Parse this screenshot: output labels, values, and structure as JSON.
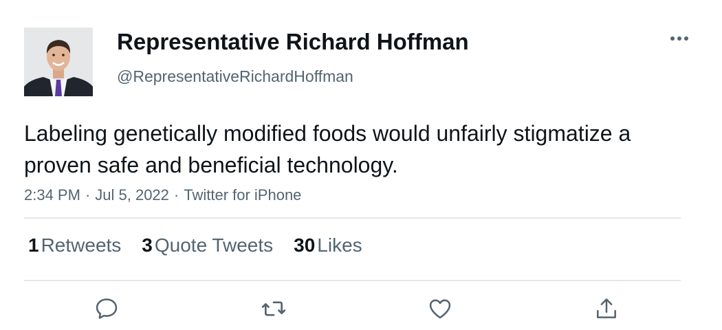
{
  "author": {
    "display_name": "Representative Richard Hoffman",
    "handle": "@RepresentativeRichardHoffman",
    "avatar_icon": "profile-photo"
  },
  "tweet": {
    "text": "Labeling genetically modified foods would unfairly stigmatize a proven safe and beneficial technology.",
    "time": "2:34 PM",
    "date": "Jul 5, 2022",
    "source": "Twitter for iPhone",
    "separator": "·"
  },
  "stats": {
    "retweets": {
      "count": "1",
      "label": "Retweets"
    },
    "quotes": {
      "count": "3",
      "label": "Quote Tweets"
    },
    "likes": {
      "count": "30",
      "label": "Likes"
    }
  },
  "actions": {
    "reply_icon": "reply-icon",
    "retweet_icon": "retweet-icon",
    "like_icon": "like-icon",
    "share_icon": "share-icon",
    "more_icon": "more-icon"
  },
  "colors": {
    "text_primary": "#0f1419",
    "text_secondary": "#536471",
    "divider": "#e3e7ea"
  }
}
